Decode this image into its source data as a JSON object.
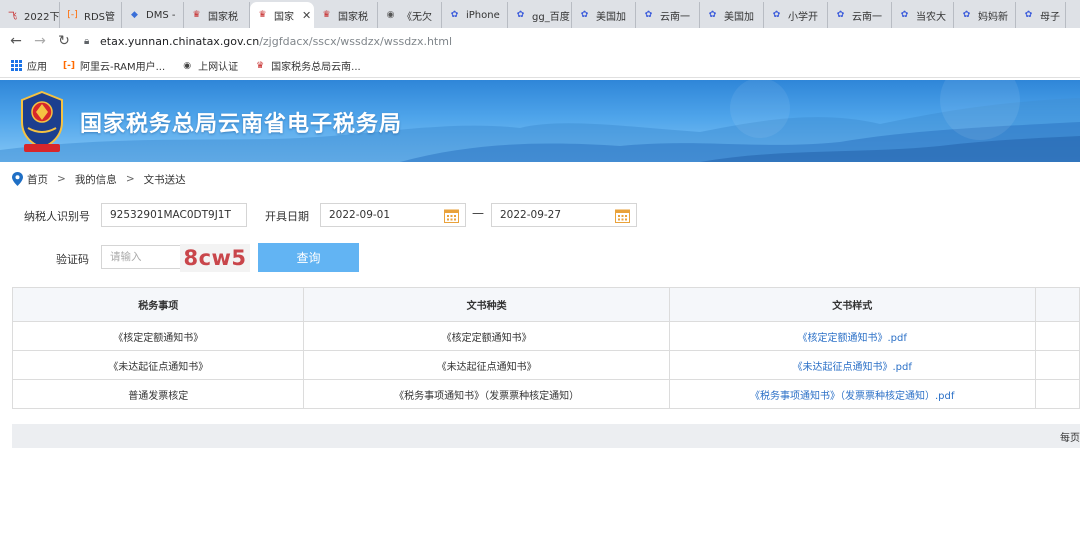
{
  "browser": {
    "tabs": [
      {
        "label": "2022下",
        "icon": "red-app-icon",
        "color": "#c62828",
        "glyph": "飞",
        "w": 60
      },
      {
        "label": "RDS管",
        "icon": "aliyun-icon",
        "color": "#ff6a00",
        "glyph": "[-]",
        "w": 62
      },
      {
        "label": "DMS -",
        "icon": "dms-icon",
        "color": "#3a6fd8",
        "glyph": "◆",
        "w": 62
      },
      {
        "label": "国家税",
        "icon": "tax-emblem-icon",
        "color": "#c62828",
        "glyph": "♛",
        "w": 66
      },
      {
        "label": "国家",
        "icon": "tax-emblem-icon",
        "color": "#c62828",
        "glyph": "♛",
        "w": 64,
        "active": true
      },
      {
        "label": "国家税",
        "icon": "tax-emblem-icon",
        "color": "#c62828",
        "glyph": "♛",
        "w": 64
      },
      {
        "label": "《无欠",
        "icon": "globe-icon",
        "color": "#555555",
        "glyph": "◉",
        "w": 64
      },
      {
        "label": "iPhone",
        "icon": "baidu-paw-icon",
        "color": "#3b5bdb",
        "glyph": "✿",
        "w": 66
      },
      {
        "label": "gg_百度",
        "icon": "baidu-paw-icon",
        "color": "#3b5bdb",
        "glyph": "✿",
        "w": 64
      },
      {
        "label": "美国加",
        "icon": "baidu-paw-icon",
        "color": "#3b5bdb",
        "glyph": "✿",
        "w": 64
      },
      {
        "label": "云南一",
        "icon": "baidu-paw-icon",
        "color": "#3b5bdb",
        "glyph": "✿",
        "w": 64
      },
      {
        "label": "美国加",
        "icon": "baidu-paw-icon",
        "color": "#3b5bdb",
        "glyph": "✿",
        "w": 64
      },
      {
        "label": "小学开",
        "icon": "baidu-paw-icon",
        "color": "#3b5bdb",
        "glyph": "✿",
        "w": 64
      },
      {
        "label": "云南一",
        "icon": "baidu-paw-icon",
        "color": "#3b5bdb",
        "glyph": "✿",
        "w": 64
      },
      {
        "label": "当农大",
        "icon": "baidu-paw-icon",
        "color": "#3b5bdb",
        "glyph": "✿",
        "w": 62
      },
      {
        "label": "妈妈新",
        "icon": "baidu-paw-icon",
        "color": "#3b5bdb",
        "glyph": "✿",
        "w": 62
      },
      {
        "label": "母子",
        "icon": "baidu-paw-icon",
        "color": "#3b5bdb",
        "glyph": "✿",
        "w": 50
      }
    ],
    "url_host": "etax.yunnan.chinatax.gov.cn",
    "url_path": "/zjgfdacx/sscx/wssdzx/wssdzx.html",
    "bookmarks": [
      {
        "label": "应用",
        "icon": "apps-grid-icon"
      },
      {
        "label": "阿里云-RAM用户...",
        "icon": "aliyun-icon"
      },
      {
        "label": "上网认证",
        "icon": "globe-icon"
      },
      {
        "label": "国家税务总局云南...",
        "icon": "tax-emblem-icon"
      }
    ]
  },
  "header": {
    "site_title": "国家税务总局云南省电子税务局",
    "colors": {
      "banner_top": "#2f86d8",
      "banner_bottom": "#86c7f6"
    }
  },
  "breadcrumb": {
    "home": "首页",
    "sep1": ">",
    "my_info": "我的信息",
    "sep2": ">",
    "current": "文书送达"
  },
  "form": {
    "taxpayer_id_label": "纳税人识别号",
    "taxpayer_id_value": "92532901MAC0DT9J1T",
    "issue_date_label": "开具日期",
    "date_from": "2022-09-01",
    "date_to": "2022-09-27",
    "date_sep": "—",
    "captcha_label": "验证码",
    "captcha_placeholder": "请输入",
    "captcha_text": "8cw5",
    "query_button": "查询"
  },
  "table": {
    "headers": [
      "税务事项",
      "文书种类",
      "文书样式",
      ""
    ],
    "rows": [
      [
        "《核定定额通知书》",
        "《核定定额通知书》",
        "《核定定额通知书》.pdf"
      ],
      [
        "《未达起征点通知书》",
        "《未达起征点通知书》",
        "《未达起征点通知书》.pdf"
      ],
      [
        "普通发票核定",
        "《税务事项通知书》（发票票种核定通知）",
        "《税务事项通知书》（发票票种核定通知）.pdf"
      ]
    ]
  },
  "pager": {
    "per_page_label": "每页"
  }
}
